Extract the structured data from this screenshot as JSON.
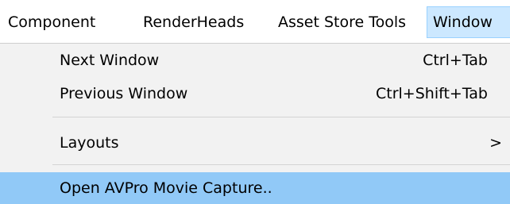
{
  "menubar": {
    "items": [
      {
        "label": "Component"
      },
      {
        "label": "RenderHeads"
      },
      {
        "label": "Asset Store Tools"
      },
      {
        "label": "Window"
      }
    ]
  },
  "window_menu": {
    "items": [
      {
        "label": "Next Window",
        "shortcut": "Ctrl+Tab"
      },
      {
        "label": "Previous Window",
        "shortcut": "Ctrl+Shift+Tab"
      },
      {
        "label": "Layouts",
        "submenu_icon": "chevron-right-icon",
        "submenu_glyph": ">"
      },
      {
        "label": "Open AVPro Movie Capture..",
        "highlighted": true
      }
    ]
  },
  "colors": {
    "highlight": "#91c9f7",
    "active_menubar_item": "#cce8ff",
    "menu_background": "#f2f2f2"
  }
}
